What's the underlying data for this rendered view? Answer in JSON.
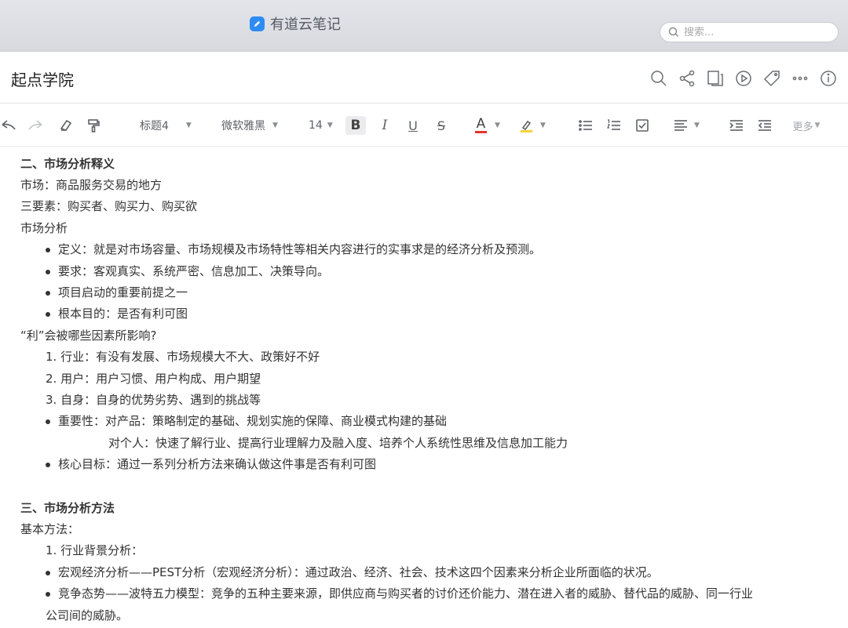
{
  "app": {
    "title": "有道云笔记",
    "search_placeholder": "搜索..."
  },
  "note": {
    "title": "起点学院"
  },
  "header_icons": [
    "search-icon",
    "share-icon",
    "copy-icon",
    "present-icon",
    "tag-icon",
    "more-icon",
    "info-icon"
  ],
  "toolbar": {
    "heading_style": "标题4",
    "font_family": "微软雅黑",
    "font_size": "14",
    "bold": "B",
    "italic": "I",
    "underline": "U",
    "strike": "S",
    "text_color": "A",
    "more": "更多"
  },
  "content": {
    "s2_heading": "二、市场分析释义",
    "l1": "市场：商品服务交易的地方",
    "l2": "三要素：购买者、购买力、购买欲",
    "l3": "市场分析",
    "b1": "定义：就是对市场容量、市场规模及市场特性等相关内容进行的实事求是的经济分析及预测。",
    "b2": "要求：客观真实、系统严密、信息加工、决策导向。",
    "b3": "项目启动的重要前提之一",
    "b4": "根本目的：是否有利可图",
    "l4": "“利”会被哪些因素所影响?",
    "n1": "1. 行业：有没有发展、市场规模大不大、政策好不好",
    "n2": "2. 用户：用户习惯、用户构成、用户期望",
    "n3": "3. 自身：自身的优势劣势、遇到的挑战等",
    "b5": "重要性：对产品：策略制定的基础、规划实施的保障、商业模式构建的基础",
    "b5b": "对个人：快速了解行业、提高行业理解力及融入度、培养个人系统性思维及信息加工能力",
    "b6": "核心目标：通过一系列分析方法来确认做这件事是否有利可图",
    "s3_heading": "三、市场分析方法",
    "l5": "基本方法：",
    "n4": "1. 行业背景分析：",
    "b7": "宏观经济分析——PEST分析（宏观经济分析）：通过政治、经济、社会、技术这四个因素来分析企业所面临的状况。",
    "b8": "竞争态势——波特五力模型：竞争的五种主要来源，即供应商与购买者的讨价还价能力、潜在进入者的威胁、替代品的威胁、同一行业",
    "b8b": "公司间的威胁。"
  },
  "colors": {
    "logo": "#2f8cf5",
    "text_color_bar": "#e5322d",
    "highlight_bar": "#f5d33a"
  }
}
